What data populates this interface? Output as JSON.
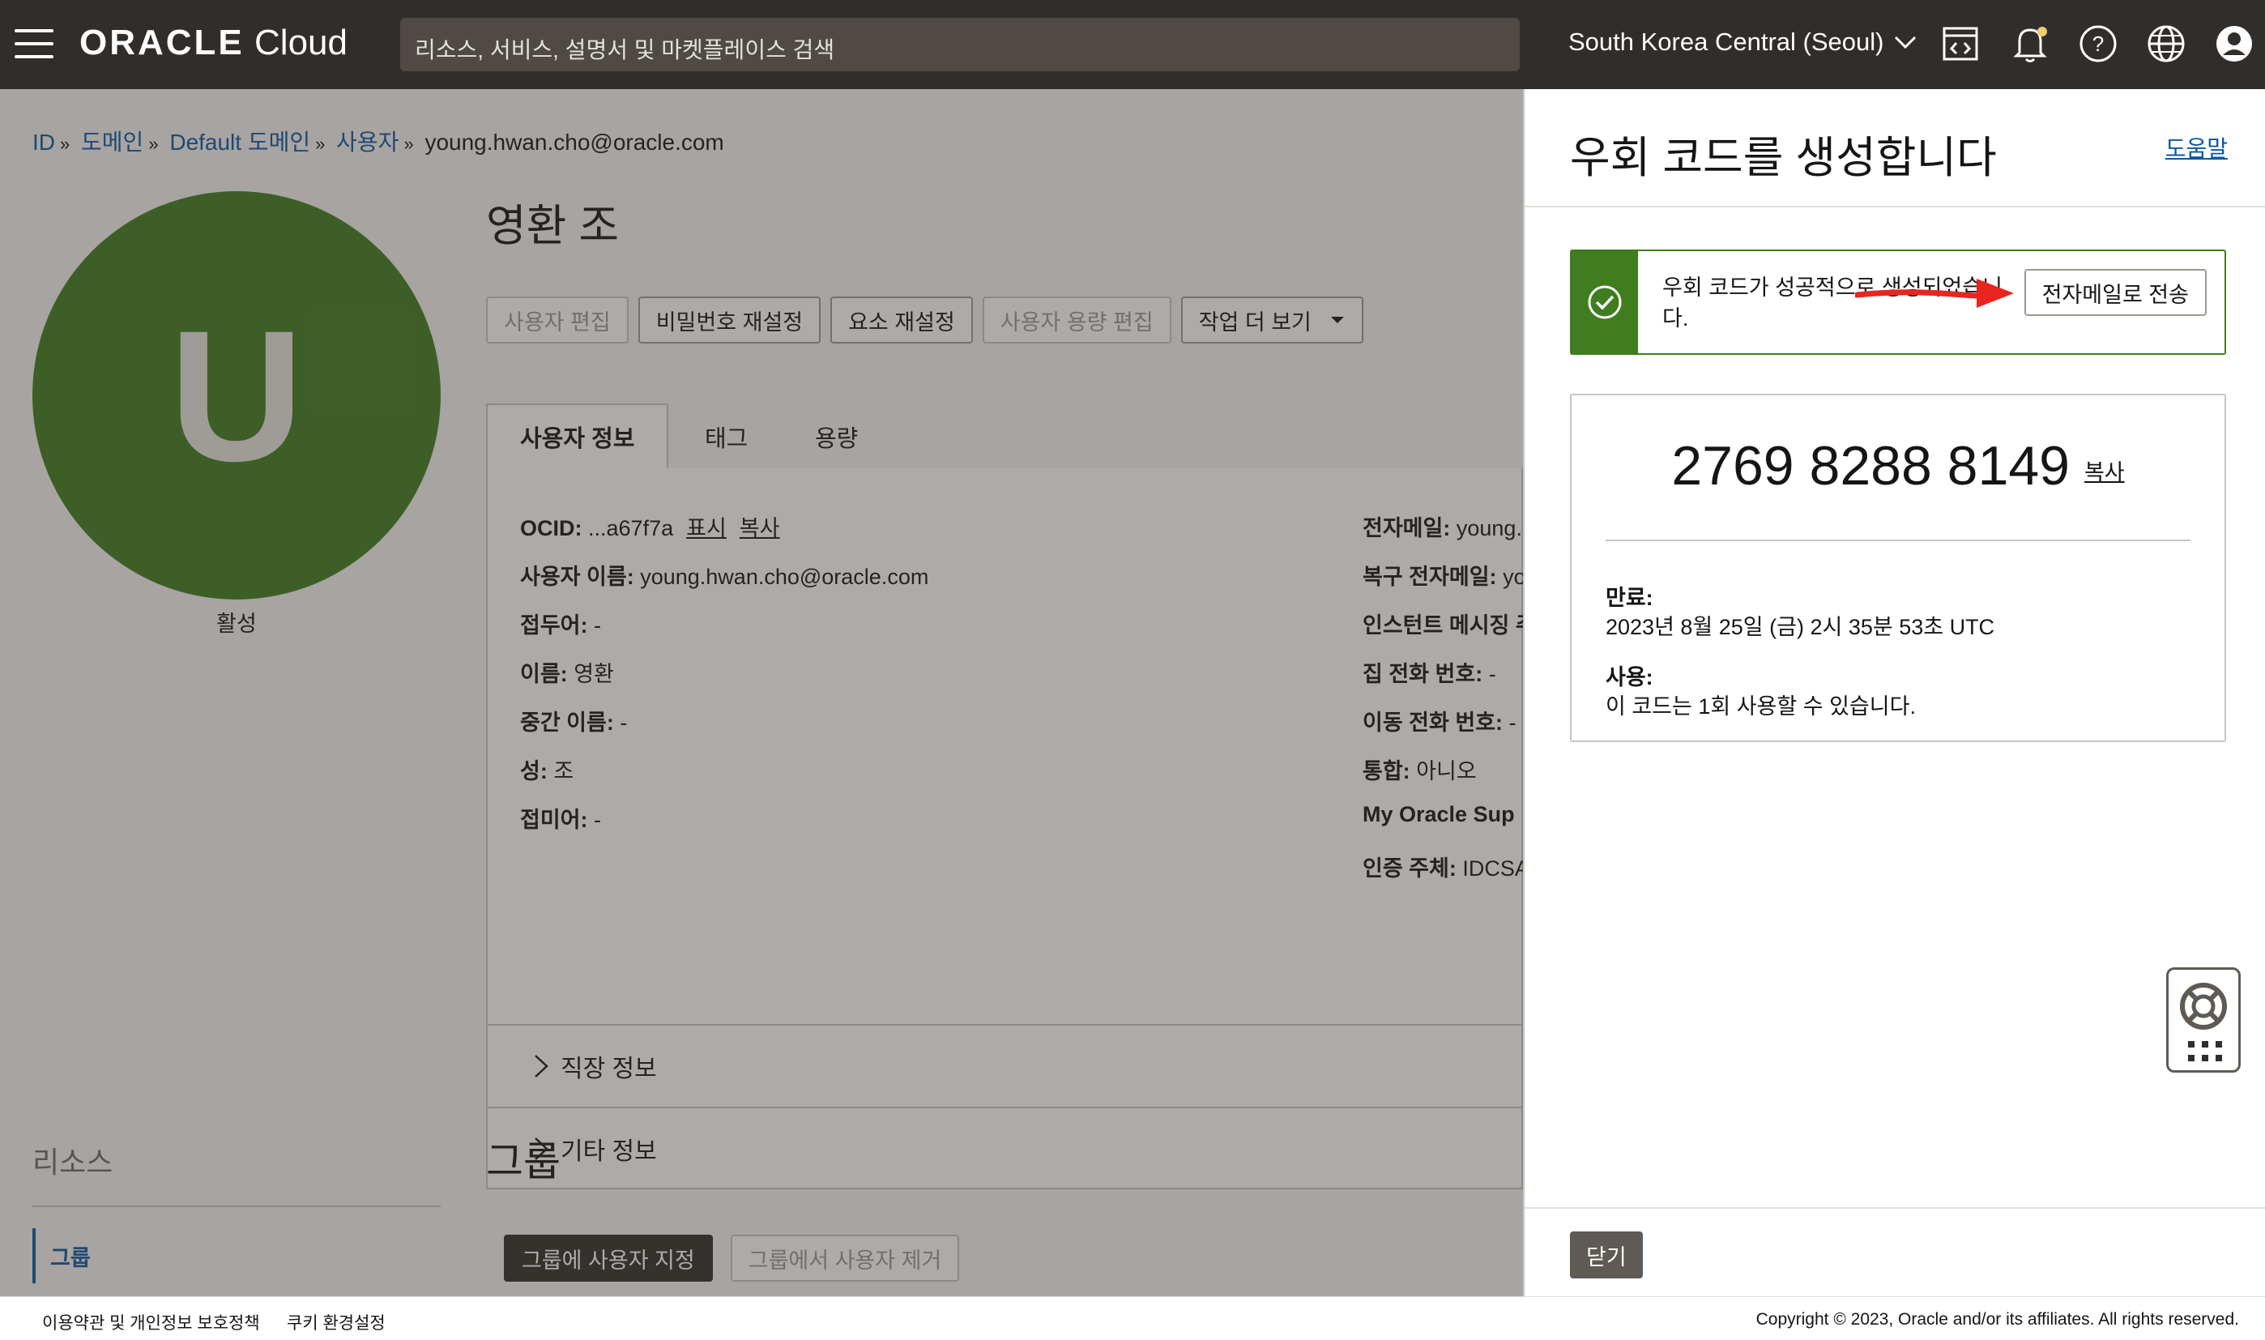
{
  "header": {
    "logo_bold": "ORACLE",
    "logo_light": "Cloud",
    "search_placeholder": "리소스, 서비스, 설명서 및 마켓플레이스 검색",
    "region": "South Korea Central (Seoul)",
    "icons": [
      "menu-icon",
      "code-editor-icon",
      "bell-icon",
      "help-icon",
      "globe-icon",
      "profile-icon"
    ]
  },
  "breadcrumb": {
    "items": [
      "ID",
      "도메인",
      "Default 도메인",
      "사용자"
    ],
    "current": "young.hwan.cho@oracle.com",
    "sep": "»"
  },
  "user": {
    "avatar_letter": "U",
    "status": "활성",
    "name": "영환 조"
  },
  "actions": {
    "edit_user": "사용자 편집",
    "reset_password": "비밀번호 재설정",
    "reset_factors": "요소 재설정",
    "edit_quota": "사용자 용량 편집",
    "more_actions": "작업 더 보기"
  },
  "tabs": [
    "사용자 정보",
    "태그",
    "용량"
  ],
  "info_left": {
    "ocid_label": "OCID:",
    "ocid_value": "...a67f7a",
    "ocid_show": "표시",
    "ocid_copy": "복사",
    "username_label": "사용자 이름:",
    "username_value": "young.hwan.cho@oracle.com",
    "prefix_label": "접두어:",
    "prefix_value": "-",
    "first_label": "이름:",
    "first_value": "영환",
    "middle_label": "중간 이름:",
    "middle_value": "-",
    "last_label": "성:",
    "last_value": "조",
    "suffix_label": "접미어:",
    "suffix_value": "-"
  },
  "info_right": {
    "email_label": "전자메일:",
    "email_value": "young.",
    "recovery_label": "복구 전자메일:",
    "recovery_value": "yo",
    "im_label": "인스턴트 메시징 주",
    "home_label": "집 전화 번호:",
    "home_value": "-",
    "mobile_label": "이동 전화 번호:",
    "mobile_value": "-",
    "federated_label": "통합:",
    "federated_value": "아니오",
    "mos_label": "My Oracle Sup",
    "auth_label": "인증 주체:",
    "auth_value": "IDCSA"
  },
  "accordions": {
    "job": "직장 정보",
    "other": "기타 정보"
  },
  "groups": {
    "title": "그룹",
    "assign_button": "그룹에 사용자 지정",
    "remove_button": "그룹에서 사용자 제거"
  },
  "resources": {
    "title": "리소스",
    "item": "그룹"
  },
  "dialog": {
    "title": "우회 코드를 생성합니다",
    "help": "도움말",
    "alert_text": "우회 코드가 성공적으로 생성되었습니다.",
    "send_email": "전자메일로 전송",
    "code": "2769 8288 8149",
    "copy": "복사",
    "expires_label": "만료:",
    "expires_value": "2023년 8월 25일 (금) 2시 35분 53초 UTC",
    "usage_label": "사용:",
    "usage_value": "이 코드는 1회 사용할 수 있습니다.",
    "close": "닫기"
  },
  "footer": {
    "terms": "이용약관 및 개인정보 보호정책",
    "cookies": "쿠키 환경설정",
    "copyright": "Copyright © 2023, Oracle and/or its affiliates. All rights reserved."
  },
  "colors": {
    "header_bg": "#312d2a",
    "success_green": "#3f7d1f",
    "link_blue": "#0b57a4",
    "annotation_red": "#e8251f"
  }
}
